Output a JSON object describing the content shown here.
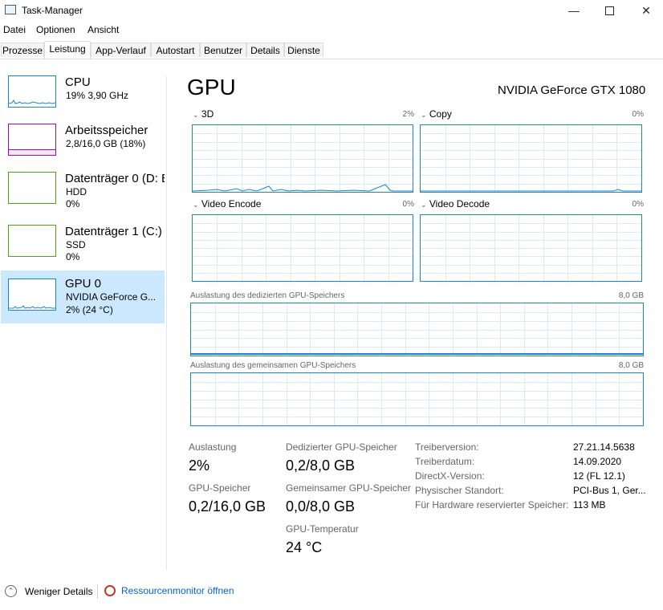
{
  "window": {
    "title": "Task-Manager"
  },
  "menu": [
    "Datei",
    "Optionen",
    "Ansicht"
  ],
  "tabs": [
    "Prozesse",
    "Leistung",
    "App-Verlauf",
    "Autostart",
    "Benutzer",
    "Details",
    "Dienste"
  ],
  "active_tab": "Leistung",
  "sidebar": [
    {
      "title": "CPU",
      "line1": "19%  3,90 GHz",
      "line2": "",
      "color": "#1a85ce"
    },
    {
      "title": "Arbeitsspeicher",
      "line1": "2,8/16,0 GB (18%)",
      "line2": "",
      "color": "#8b12ae"
    },
    {
      "title": "Datenträger 0 (D: E",
      "line1": "HDD",
      "line2": "0%",
      "color": "#4da60c"
    },
    {
      "title": "Datenträger 1 (C:)",
      "line1": "SSD",
      "line2": "0%",
      "color": "#4da60c"
    },
    {
      "title": "GPU 0",
      "line1": "NVIDIA GeForce G...",
      "line2": "2%  (24 °C)",
      "color": "#1a85ce"
    }
  ],
  "main": {
    "heading": "GPU",
    "model": "NVIDIA GeForce GTX 1080",
    "engines": [
      {
        "label": "3D",
        "pct": "2%"
      },
      {
        "label": "Copy",
        "pct": "0%"
      },
      {
        "label": "Video Encode",
        "pct": "0%"
      },
      {
        "label": "Video Decode",
        "pct": "0%"
      }
    ],
    "dedicated_label": "Auslastung des dedizierten GPU-Speichers",
    "dedicated_max": "8,0 GB",
    "shared_label": "Auslastung des gemeinsamen GPU-Speichers",
    "shared_max": "8,0 GB"
  },
  "stats": {
    "utilization_label": "Auslastung",
    "utilization_value": "2%",
    "gpu_mem_label": "GPU-Speicher",
    "gpu_mem_value": "0,2/16,0 GB",
    "dedicated_label": "Dedizierter GPU-Speicher",
    "dedicated_value": "0,2/8,0 GB",
    "shared_label": "Gemeinsamer GPU-Speicher",
    "shared_value": "0,0/8,0 GB",
    "temp_label": "GPU-Temperatur",
    "temp_value": "24 °C"
  },
  "info": [
    {
      "key": "Treiberversion:",
      "value": "27.21.14.5638"
    },
    {
      "key": "Treiberdatum:",
      "value": "14.09.2020"
    },
    {
      "key": "DirectX-Version:",
      "value": "12 (FL 12.1)"
    },
    {
      "key": "Physischer Standort:",
      "value": "PCI-Bus 1, Ger..."
    },
    {
      "key": "Für Hardware reservierter Speicher:",
      "value": "113 MB"
    }
  ],
  "footer": {
    "fewer_details": "Weniger Details",
    "resource_monitor": "Ressourcenmonitor öffnen"
  }
}
